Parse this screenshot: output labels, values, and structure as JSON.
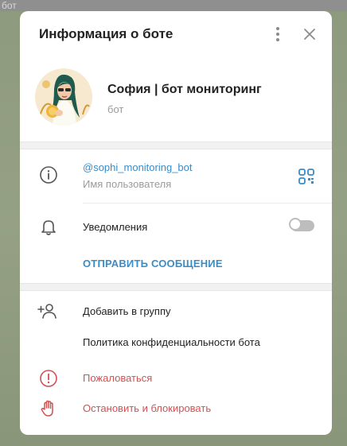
{
  "background": {
    "label": "бот"
  },
  "modal": {
    "title": "Информация о боте"
  },
  "profile": {
    "name": "София | бот мониторинг",
    "subtitle": "бот"
  },
  "info": {
    "username": "@sophi_monitoring_bot",
    "username_caption": "Имя пользователя",
    "notifications_label": "Уведомления",
    "notifications_enabled": false,
    "send_message_label": "ОТПРАВИТЬ СООБЩЕНИЕ"
  },
  "actions": {
    "add_to_group": "Добавить в группу",
    "privacy_policy": "Политика конфиденциальности бота",
    "report": "Пожаловаться",
    "stop_and_block": "Остановить и блокировать"
  },
  "colors": {
    "accent": "#3a8cc7",
    "danger": "#d05252",
    "text": "#222222",
    "secondary": "#9b9b9b",
    "toggle_off": "#bdbdbd"
  },
  "icons": {
    "more": "kebab-menu-icon",
    "close": "close-icon",
    "info": "info-icon",
    "qr": "qr-code-icon",
    "bell": "bell-icon",
    "add_user": "add-user-icon",
    "report": "alert-icon",
    "block": "hand-stop-icon"
  }
}
